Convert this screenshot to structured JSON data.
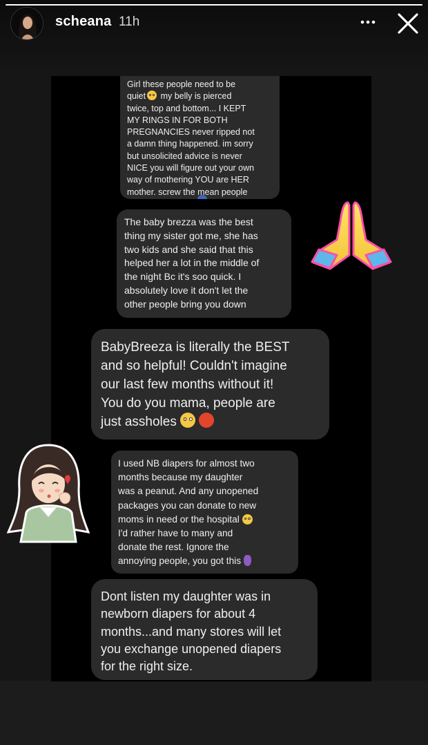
{
  "story": {
    "username": "scheana",
    "timestamp": "11h",
    "progress": 1.0,
    "header_icons": {
      "more": "more-horizontal-icon",
      "close": "close-icon"
    }
  },
  "messages": [
    {
      "id": "b1",
      "lines": [
        "Girl these people need to be",
        "quiet [emoji] my belly is pierced",
        "twice, top and bottom... I KEPT",
        "MY RINGS IN FOR BOTH",
        "PREGNANCIES never ripped not",
        "a damn thing happened. im sorry",
        "but unsolicited advice is never",
        "NICE you will figure out your own",
        "way of mothering YOU are HER",
        "mother. screw the mean people"
      ]
    },
    {
      "id": "b2",
      "lines": [
        "The baby brezza was the best",
        "thing my sister got me, she has",
        "two kids and she said that this",
        "helped her a lot in the middle of",
        "the night Bc it's soo quick. I",
        "absolutely love it don't let the",
        "other people bring you down"
      ]
    },
    {
      "id": "b3",
      "lines": [
        "BabyBreeza is literally the BEST",
        "and so helpful! Couldn't imagine",
        "our last few months without it!",
        "You do you mama, people are",
        "just assholes"
      ]
    },
    {
      "id": "b4",
      "lines": [
        "I used NB diapers for almost two",
        "months because my daughter",
        "was a peanut. And any unopened",
        "packages you can donate to new",
        "moms in need or the hospital",
        "I'd rather have to many and",
        "donate the rest. Ignore the",
        "annoying people, you got this"
      ]
    },
    {
      "id": "b5",
      "lines": [
        "Dont listen my daughter was in",
        "newborn diapers for about 4",
        "months...and many stores will let",
        "you exchange unopened diapers",
        "for the right size."
      ]
    }
  ],
  "emojis": {
    "b1_line2": "dizzy-face-emoji",
    "b3_end": [
      "eye-roll-emoji",
      "angry-cursing-emoji"
    ],
    "b4_line5": "eye-roll-emoji",
    "b4_end": "pregnant-woman-emoji"
  },
  "stickers": [
    "praying-hands-sticker",
    "girl-blowing-kiss-sticker"
  ],
  "colors": {
    "background": "#161616",
    "bubble": "#2b2b2b",
    "text": "#ffffff"
  }
}
